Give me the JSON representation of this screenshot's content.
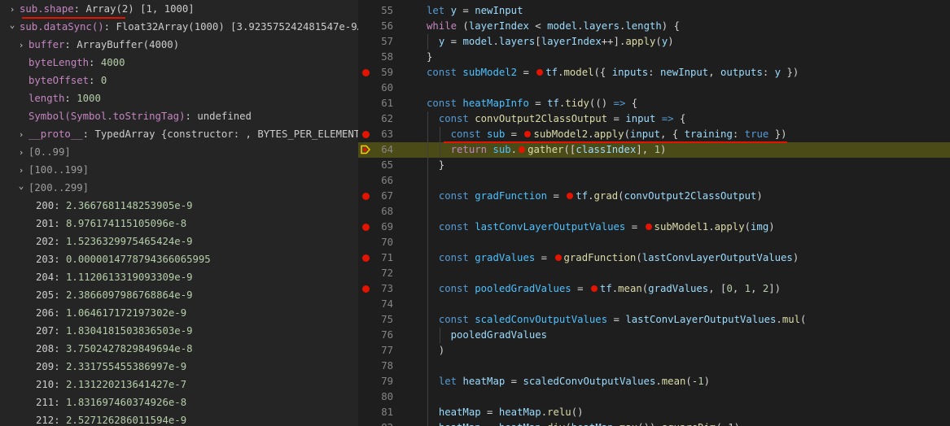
{
  "debug": {
    "shape": {
      "name": "sub.shape",
      "value": "Array(2) [1, 1000]"
    },
    "dataSync": {
      "name": "sub.dataSync()",
      "value": "Float32Array(1000) [3.923575242481547e-9…"
    },
    "props": [
      {
        "name": "buffer",
        "value": "ArrayBuffer(4000)"
      },
      {
        "name": "byteLength",
        "value": "4000"
      },
      {
        "name": "byteOffset",
        "value": "0"
      },
      {
        "name": "length",
        "value": "1000"
      },
      {
        "name": "Symbol(Symbol.toStringTag)",
        "value": "undefined"
      },
      {
        "name": "__proto__",
        "value": "TypedArray {constructor: , BYTES_PER_ELEMENT…"
      }
    ],
    "ranges": [
      "[0..99]",
      "[100..199]",
      "[200..299]"
    ],
    "values": [
      {
        "index": "200",
        "value": "2.3667681148253905e-9"
      },
      {
        "index": "201",
        "value": "8.976174115105096e-8"
      },
      {
        "index": "202",
        "value": "1.5236329975465424e-9"
      },
      {
        "index": "203",
        "value": "0.000001477879436606599 5"
      },
      {
        "index": "204",
        "value": "1.1120613319093309e-9"
      },
      {
        "index": "205",
        "value": "2.3866097986768864e-9"
      },
      {
        "index": "206",
        "value": "1.064617172197302e-9"
      },
      {
        "index": "207",
        "value": "1.8304181503836503e-9"
      },
      {
        "index": "208",
        "value": "3.7502427829849694e-8"
      },
      {
        "index": "209",
        "value": "2.331755455386997e-9"
      },
      {
        "index": "210",
        "value": "2.131220213641427e-7"
      },
      {
        "index": "211",
        "value": "1.831697460374926e-8"
      },
      {
        "index": "212",
        "value": "2.527126286011594e-9"
      }
    ]
  },
  "editor": {
    "line_numbers": [
      "55",
      "56",
      "57",
      "58",
      "59",
      "60",
      "61",
      "62",
      "63",
      "64",
      "65",
      "66",
      "67",
      "68",
      "69",
      "70",
      "71",
      "72",
      "73",
      "74",
      "75",
      "76",
      "77",
      "78",
      "79",
      "80",
      "81",
      "82"
    ],
    "partial_line": "heatMap = heatMap.div(heatMap.max()).squareDim(-1)",
    "colors": {
      "breakpoint": "#e51400",
      "current_line": "#4b4b18",
      "annotation": "#e51400"
    }
  }
}
